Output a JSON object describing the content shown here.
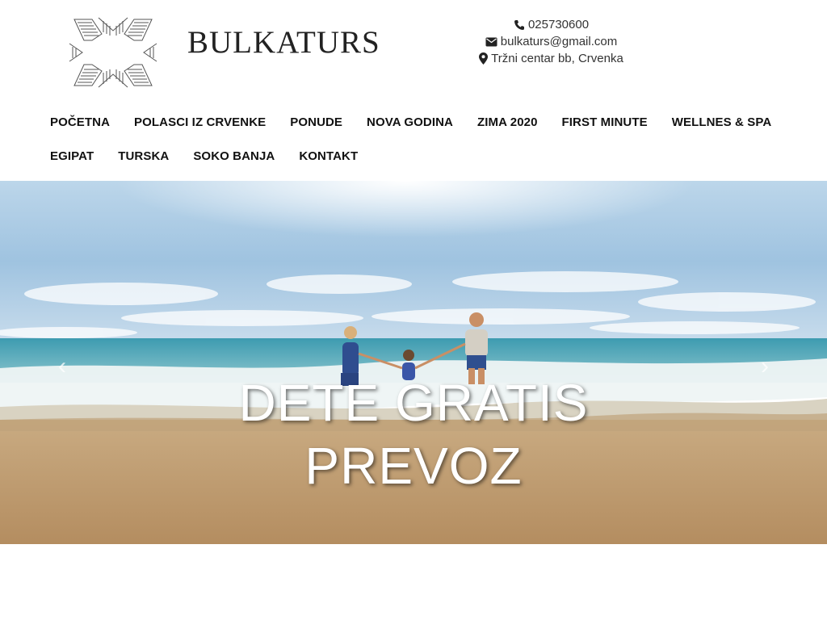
{
  "brand": {
    "name": "BULKATURS"
  },
  "contact": {
    "phone": "025730600",
    "email": "bulkaturs@gmail.com",
    "address": "Tržni centar bb, Crvenka"
  },
  "nav": {
    "row1": [
      "POČETNA",
      "POLASCI IZ CRVENKE",
      "PONUDE",
      "NOVA GODINA",
      "ZIMA 2020",
      "FIRST MINUTE",
      "WELLNES & SPA"
    ],
    "row2": [
      "EGIPAT",
      "TURSKA",
      "SOKO BANJA",
      "KONTAKT"
    ]
  },
  "hero": {
    "caption_line1": "DETE GRATIS",
    "caption_line2": "PREVOZ",
    "prev_glyph": "‹",
    "next_glyph": "›"
  },
  "icons": [
    "logo-icon",
    "phone-icon",
    "envelope-icon",
    "map-marker-icon",
    "chevron-left-icon",
    "chevron-right-icon"
  ]
}
